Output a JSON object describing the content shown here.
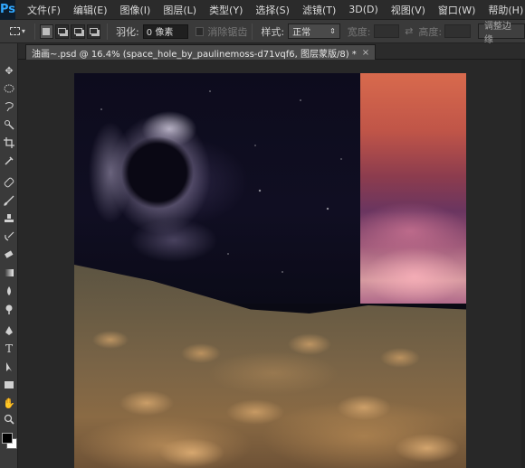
{
  "app": {
    "logo": "Ps"
  },
  "menu": [
    "文件(F)",
    "编辑(E)",
    "图像(I)",
    "图层(L)",
    "类型(Y)",
    "选择(S)",
    "滤镜(T)",
    "3D(D)",
    "视图(V)",
    "窗口(W)",
    "帮助(H)"
  ],
  "options": {
    "feather_label": "羽化:",
    "feather_value": "0 像素",
    "antialias_label": "消除锯齿",
    "style_label": "样式:",
    "style_value": "正常",
    "width_label": "宽度:",
    "height_label": "高度:",
    "adjust_edge_label": "调整边缘"
  },
  "tab": {
    "title": "油画~.psd @ 16.4% (space_hole_by_paulinemoss-d71vqf6, 图层蒙版/8) *",
    "close": "×"
  },
  "tools": [
    "move-icon",
    "marquee-icon",
    "lasso-icon",
    "quick-select-icon",
    "crop-icon",
    "eyedropper-icon",
    "healing-icon",
    "brush-icon",
    "stamp-icon",
    "history-brush-icon",
    "eraser-icon",
    "gradient-icon",
    "blur-icon",
    "dodge-icon",
    "pen-icon",
    "type-icon",
    "path-select-icon",
    "shape-icon",
    "hand-icon",
    "zoom-icon"
  ],
  "colors": {
    "foreground": "#000000",
    "background": "#ffffff"
  }
}
